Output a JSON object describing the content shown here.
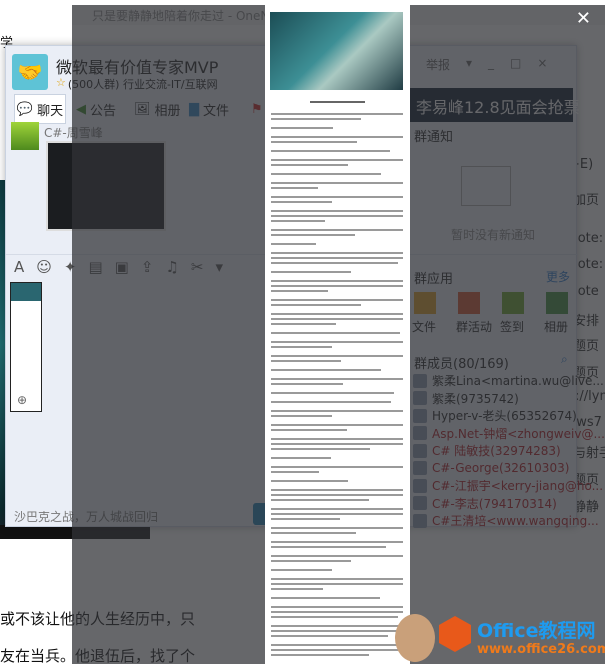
{
  "onenote": {
    "title": "只是要静静地陪着你走过 - OneNote",
    "left_fragment": "学",
    "body_lines": [
      "或不该让他的人生经历中，只",
      "友在当兵。他退伍后，找了个"
    ],
    "pages": [
      "rl+E)",
      "添加页",
      "eNote:",
      "eNote:",
      "eNote",
      "日安排",
      "标题页",
      "标题页",
      "ps://lyn",
      "dows7",
      "人与射手",
      "标题页",
      "要静静"
    ]
  },
  "qq": {
    "group_name": "微软最有价值专家MVP",
    "group_info": "(500人群) 行业交流-IT/互联网",
    "tabs": [
      "聊天",
      "公告",
      "相册",
      "文件"
    ],
    "controls": {
      "report": "举报",
      "min": "_",
      "max": "□",
      "close": "×"
    },
    "banner": "李易峰12.8见面会抢票",
    "notice_title": "群通知",
    "notice_empty": "暂时没有新通知",
    "apps_title": "群应用",
    "apps_more": "更多",
    "apps": [
      {
        "label": "文件",
        "color": "#e0a020"
      },
      {
        "label": "群活动",
        "color": "#d9532c"
      },
      {
        "label": "签到",
        "color": "#6aa82a"
      },
      {
        "label": "相册",
        "color": "#3f8f3a"
      }
    ],
    "chat_sender": "C#-周雪峰",
    "input_text": "沙巴克之战，万人城战回归",
    "members_title": "群成员(80/169)",
    "members": [
      {
        "name": "紫柔Lina<martina.wu@live....",
        "red": false
      },
      {
        "name": "紫柔(9735742)",
        "red": false
      },
      {
        "name": "Hyper-v-老头(65352674)",
        "red": false
      },
      {
        "name": "Asp.Net-钟熠<zhongweiv@...",
        "red": true
      },
      {
        "name": "C# 陆敏技(32974283)",
        "red": true
      },
      {
        "name": "C#-George(32610303)",
        "red": true
      },
      {
        "name": "C#-江振宇<kerry-jiang@ho...",
        "red": true
      },
      {
        "name": "C#-李志(794170314)",
        "red": true
      },
      {
        "name": "C#王清培<www.wangqing...",
        "red": true
      }
    ]
  },
  "viewer": {
    "close": "✕"
  },
  "watermark": {
    "line1": "Office教程网",
    "line2": "www.office26.com"
  }
}
